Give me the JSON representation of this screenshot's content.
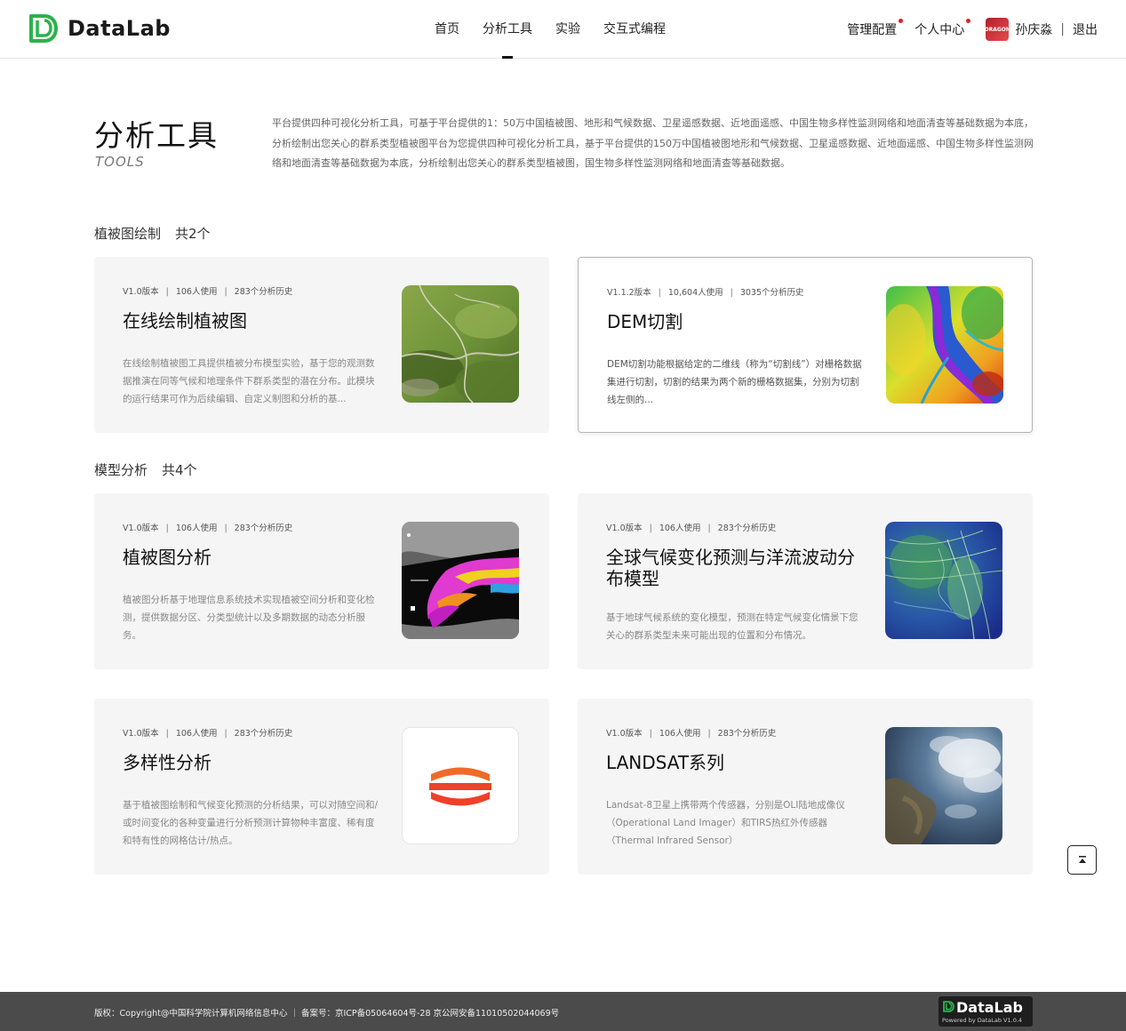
{
  "brand": {
    "name": "DataLab",
    "accent": "#2bb24c"
  },
  "nav": {
    "items": [
      {
        "label": "首页",
        "active": false
      },
      {
        "label": "分析工具",
        "active": true
      },
      {
        "label": "实验",
        "active": false
      },
      {
        "label": "交互式编程",
        "active": false
      }
    ]
  },
  "user_bar": {
    "admin_label": "管理配置",
    "profile_label": "个人中心",
    "avatar_text": "DRAGON",
    "username": "孙庆淼",
    "separator": "|",
    "logout_label": "退出"
  },
  "intro": {
    "title": "分析工具",
    "subtitle": "TOOLS",
    "description": "平台提供四种可视化分析工具，可基于平台提供的1：50万中国植被图、地形和气候数据、卫星遥感数据、近地面遥感、中国生物多样性监测网络和地面清查等基础数据为本底，分析绘制出您关心的群系类型植被图平台为您提供四种可视化分析工具，基于平台提供的150万中国植被图地形和气候数据、卫星遥感数据、近地面遥感、中国生物多样性监测网络和地面清查等基础数据为本底，分析绘制出您关心的群系类型植被图，国生物多样性监测网络和地面清查等基础数据。"
  },
  "sections": [
    {
      "title": "植被图绘制",
      "count": "共2个",
      "cards": [
        {
          "version": "V1.0版本",
          "users": "106人使用",
          "history": "283个分析历史",
          "title": "在线绘制植被图",
          "description": "在线绘制植被图工具提供植被分布模型实验，基于您的观测数据推演在同等气候和地理条件下群系类型的潜在分布。此模块的运行结果可作为后续编辑、自定义制图和分析的基...",
          "thumb": "terrain-aerial"
        },
        {
          "version": "V1.1.2版本",
          "users": "10,604人使用",
          "history": "3035个分析历史",
          "title": "DEM切割",
          "description": "DEM切割功能根据给定的二维线（称为“切割线”）对栅格数据集进行切割，切割的结果为两个新的栅格数据集，分别为切割线左侧的...",
          "thumb": "dem-heatmap"
        }
      ]
    },
    {
      "title": "模型分析",
      "count": "共4个",
      "cards": [
        {
          "version": "V1.0版本",
          "users": "106人使用",
          "history": "283个分析历史",
          "title": "植被图分析",
          "description": "植被图分析基于地理信息系统技术实现植被空间分析和变化检测，提供数据分区、分类型统计以及多期数据的动态分析服务。",
          "thumb": "vegetation-map"
        },
        {
          "version": "V1.0版本",
          "users": "106人使用",
          "history": "283个分析历史",
          "title": "全球气候变化预测与洋流波动分布模型",
          "description": "基于地球气候系统的变化模型，预测在特定气候变化情景下您关心的群系类型未来可能出现的位置和分布情况。",
          "thumb": "wind-flow"
        },
        {
          "version": "V1.0版本",
          "users": "106人使用",
          "history": "283个分析历史",
          "title": "多样性分析",
          "description": "基于植被图绘制和气候变化预测的分析结果，可以对随空间和/或时间变化的各种变量进行分析预测计算物种丰富度、稀有度和特有性的网格估计/热点。",
          "thumb": "diversity-logo"
        },
        {
          "version": "V1.0版本",
          "users": "106人使用",
          "history": "283个分析历史",
          "title": "LANDSAT系列",
          "description": "Landsat-8卫星上携带两个传感器，分别是OLI陆地成像仪（Operational Land Imager）和TIRS热红外传感器（Thermal Infrared Sensor）",
          "thumb": "satellite-earth"
        }
      ]
    }
  ],
  "footer": {
    "text": "版权：Copyright@中国科学院计算机网络信息中心 ｜ 备案号：京ICP备05064604号-28   京公网安备11010502044069号",
    "badge_name": "DataLab",
    "badge_powered": "Powered by DataLab V1.0.4"
  }
}
